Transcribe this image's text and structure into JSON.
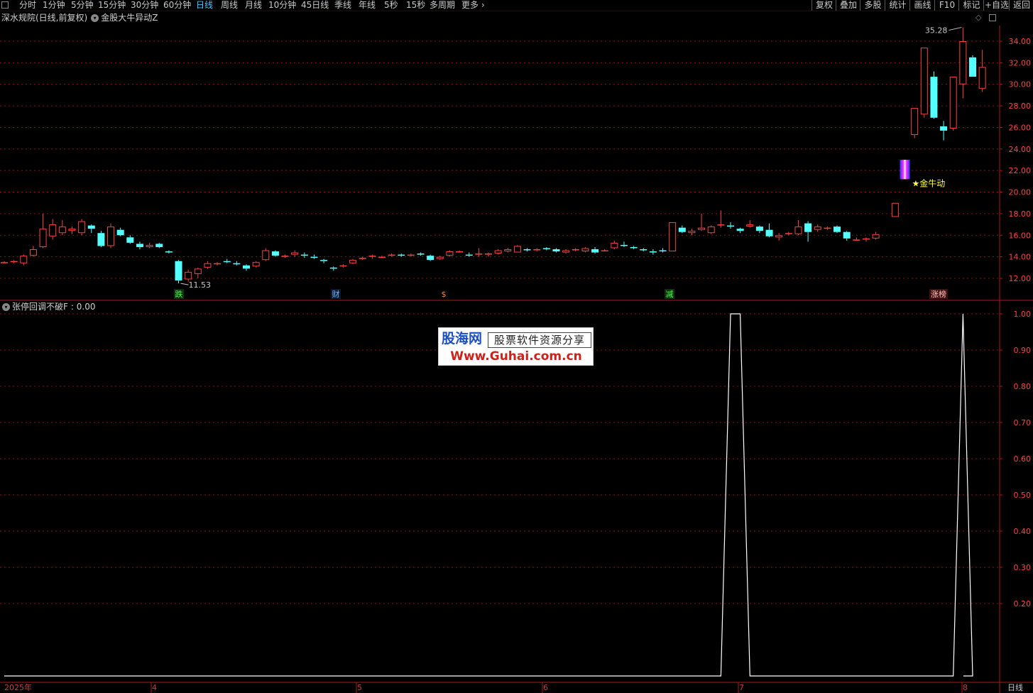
{
  "toolbar": {
    "periods": [
      "分时",
      "1分钟",
      "5分钟",
      "15分钟",
      "30分钟",
      "60分钟",
      "日线",
      "周线",
      "月线",
      "10分钟",
      "45日线",
      "季线",
      "年线",
      "5秒",
      "15秒",
      "多周期",
      "更多 ›"
    ],
    "active_period": "日线",
    "right_buttons": [
      "复权",
      "叠加",
      "多股",
      "统计",
      "画线",
      "F10",
      "标记",
      "+自选",
      "返回"
    ]
  },
  "info": {
    "stock_name": "深水规院(日线,前复权)",
    "indicator_name": "金股大牛异动Z"
  },
  "indicator_panel": {
    "title": "张停回调不破F",
    "value_label": ": 0.00"
  },
  "annotations": {
    "max_price_label": "35.28",
    "min_price_label": "11.53",
    "signal_label": "★金牛动",
    "event_markers": [
      "跌",
      "财",
      "$",
      "减",
      "涨榜"
    ]
  },
  "watermark": {
    "brand": "股海网",
    "slogan": "股票软件资源分享",
    "url": "Www.Guhai.com.cn"
  },
  "bottom": {
    "year_label": "2025年",
    "month_labels": [
      "4",
      "5",
      "6",
      "7",
      "8"
    ],
    "period_label": "日线"
  },
  "colors": {
    "up": "#ff4040",
    "down": "#54ffff",
    "grid": "#8b1010",
    "axis": "#b01818",
    "indicator_line": "#ffffff",
    "active_tab": "#3ec8ff"
  },
  "chart_data": [
    {
      "type": "candlestick",
      "title": "深水规院(日线,前复权)",
      "y_ticks": [
        "34.00",
        "32.00",
        "30.00",
        "28.00",
        "26.00",
        "24.00",
        "22.00",
        "20.00",
        "18.00",
        "16.00",
        "14.00",
        "12.00"
      ],
      "ylim": [
        10.5,
        35.9
      ],
      "candles": [
        {
          "o": 13.5,
          "h": 13.6,
          "l": 13.4,
          "c": 13.5
        },
        {
          "o": 13.5,
          "h": 13.7,
          "l": 13.4,
          "c": 13.6
        },
        {
          "o": 13.4,
          "h": 14.2,
          "l": 13.2,
          "c": 14.1
        },
        {
          "o": 14.1,
          "h": 15.0,
          "l": 14.0,
          "c": 14.7
        },
        {
          "o": 14.9,
          "h": 18.0,
          "l": 14.8,
          "c": 16.6
        },
        {
          "o": 15.9,
          "h": 17.5,
          "l": 15.6,
          "c": 17.0
        },
        {
          "o": 16.2,
          "h": 17.4,
          "l": 16.0,
          "c": 16.8
        },
        {
          "o": 16.4,
          "h": 16.8,
          "l": 16.1,
          "c": 16.6
        },
        {
          "o": 16.2,
          "h": 17.5,
          "l": 16.0,
          "c": 17.3
        },
        {
          "o": 16.9,
          "h": 17.0,
          "l": 16.2,
          "c": 16.6
        },
        {
          "o": 16.2,
          "h": 16.4,
          "l": 14.9,
          "c": 15.0
        },
        {
          "o": 15.0,
          "h": 17.1,
          "l": 14.8,
          "c": 16.8
        },
        {
          "o": 16.5,
          "h": 16.7,
          "l": 15.9,
          "c": 16.0
        },
        {
          "o": 15.8,
          "h": 16.0,
          "l": 15.2,
          "c": 15.3
        },
        {
          "o": 15.2,
          "h": 15.4,
          "l": 14.7,
          "c": 14.9
        },
        {
          "o": 14.9,
          "h": 15.3,
          "l": 14.8,
          "c": 15.1
        },
        {
          "o": 15.2,
          "h": 15.3,
          "l": 14.8,
          "c": 14.9
        },
        {
          "o": 14.5,
          "h": 14.6,
          "l": 14.3,
          "c": 14.4
        },
        {
          "o": 13.6,
          "h": 13.7,
          "l": 11.53,
          "c": 11.8
        },
        {
          "o": 11.9,
          "h": 12.8,
          "l": 11.7,
          "c": 12.6
        },
        {
          "o": 12.4,
          "h": 13.0,
          "l": 12.0,
          "c": 12.9
        },
        {
          "o": 13.0,
          "h": 13.6,
          "l": 12.9,
          "c": 13.4
        },
        {
          "o": 13.3,
          "h": 13.5,
          "l": 13.2,
          "c": 13.4
        },
        {
          "o": 13.6,
          "h": 13.8,
          "l": 13.4,
          "c": 13.5
        },
        {
          "o": 13.4,
          "h": 13.6,
          "l": 13.2,
          "c": 13.3
        },
        {
          "o": 13.2,
          "h": 13.3,
          "l": 12.7,
          "c": 12.9
        },
        {
          "o": 13.1,
          "h": 13.6,
          "l": 13.0,
          "c": 13.5
        },
        {
          "o": 13.7,
          "h": 14.8,
          "l": 13.6,
          "c": 14.6
        },
        {
          "o": 14.5,
          "h": 14.6,
          "l": 14.0,
          "c": 14.1
        },
        {
          "o": 14.0,
          "h": 14.2,
          "l": 13.9,
          "c": 14.1
        },
        {
          "o": 14.2,
          "h": 14.6,
          "l": 14.0,
          "c": 14.4
        },
        {
          "o": 14.2,
          "h": 14.4,
          "l": 13.9,
          "c": 14.1
        },
        {
          "o": 14.0,
          "h": 14.2,
          "l": 13.8,
          "c": 13.9
        },
        {
          "o": 13.7,
          "h": 13.8,
          "l": 13.4,
          "c": 13.6
        },
        {
          "o": 13.0,
          "h": 13.1,
          "l": 12.7,
          "c": 12.9
        },
        {
          "o": 13.1,
          "h": 13.3,
          "l": 13.0,
          "c": 13.2
        },
        {
          "o": 13.4,
          "h": 13.8,
          "l": 13.3,
          "c": 13.7
        },
        {
          "o": 13.8,
          "h": 14.0,
          "l": 13.7,
          "c": 13.9
        },
        {
          "o": 14.0,
          "h": 14.2,
          "l": 13.8,
          "c": 14.1
        },
        {
          "o": 14.0,
          "h": 14.1,
          "l": 13.9,
          "c": 14.0
        },
        {
          "o": 14.1,
          "h": 14.3,
          "l": 14.0,
          "c": 14.2
        },
        {
          "o": 14.2,
          "h": 14.3,
          "l": 14.0,
          "c": 14.1
        },
        {
          "o": 14.1,
          "h": 14.3,
          "l": 14.0,
          "c": 14.2
        },
        {
          "o": 14.3,
          "h": 14.4,
          "l": 14.1,
          "c": 14.2
        },
        {
          "o": 14.1,
          "h": 14.2,
          "l": 13.6,
          "c": 13.7
        },
        {
          "o": 13.8,
          "h": 14.1,
          "l": 13.7,
          "c": 14.0
        },
        {
          "o": 14.1,
          "h": 14.6,
          "l": 14.0,
          "c": 14.5
        },
        {
          "o": 14.5,
          "h": 14.6,
          "l": 14.4,
          "c": 14.5
        },
        {
          "o": 14.2,
          "h": 14.4,
          "l": 14.0,
          "c": 14.1
        },
        {
          "o": 14.2,
          "h": 14.8,
          "l": 14.0,
          "c": 14.3
        },
        {
          "o": 14.2,
          "h": 14.4,
          "l": 14.0,
          "c": 14.3
        },
        {
          "o": 14.3,
          "h": 14.7,
          "l": 14.2,
          "c": 14.6
        },
        {
          "o": 14.5,
          "h": 14.8,
          "l": 14.4,
          "c": 14.7
        },
        {
          "o": 14.4,
          "h": 15.1,
          "l": 14.4,
          "c": 15.0
        },
        {
          "o": 14.7,
          "h": 14.8,
          "l": 14.5,
          "c": 14.6
        },
        {
          "o": 14.6,
          "h": 14.8,
          "l": 14.5,
          "c": 14.7
        },
        {
          "o": 14.8,
          "h": 14.9,
          "l": 14.6,
          "c": 14.7
        },
        {
          "o": 14.7,
          "h": 14.8,
          "l": 14.4,
          "c": 14.5
        },
        {
          "o": 14.4,
          "h": 14.7,
          "l": 14.3,
          "c": 14.6
        },
        {
          "o": 14.6,
          "h": 14.8,
          "l": 14.5,
          "c": 14.7
        },
        {
          "o": 14.5,
          "h": 14.9,
          "l": 14.4,
          "c": 14.8
        },
        {
          "o": 14.7,
          "h": 14.9,
          "l": 14.3,
          "c": 14.4
        },
        {
          "o": 14.6,
          "h": 14.7,
          "l": 14.5,
          "c": 14.6
        },
        {
          "o": 14.8,
          "h": 15.5,
          "l": 14.7,
          "c": 15.3
        },
        {
          "o": 15.1,
          "h": 15.4,
          "l": 14.9,
          "c": 15.0
        },
        {
          "o": 14.9,
          "h": 15.0,
          "l": 14.7,
          "c": 14.8
        },
        {
          "o": 14.7,
          "h": 14.8,
          "l": 14.5,
          "c": 14.6
        },
        {
          "o": 14.5,
          "h": 14.7,
          "l": 14.2,
          "c": 14.4
        },
        {
          "o": 14.6,
          "h": 14.8,
          "l": 14.4,
          "c": 14.5
        },
        {
          "o": 14.5,
          "h": 17.2,
          "l": 14.5,
          "c": 17.2
        },
        {
          "o": 16.7,
          "h": 16.9,
          "l": 16.2,
          "c": 16.3
        },
        {
          "o": 16.2,
          "h": 16.6,
          "l": 16.0,
          "c": 16.4
        },
        {
          "o": 16.5,
          "h": 18.0,
          "l": 16.4,
          "c": 16.7
        },
        {
          "o": 16.2,
          "h": 16.9,
          "l": 16.1,
          "c": 16.8
        },
        {
          "o": 16.9,
          "h": 18.3,
          "l": 16.7,
          "c": 17.0
        },
        {
          "o": 16.9,
          "h": 17.2,
          "l": 16.6,
          "c": 16.8
        },
        {
          "o": 16.6,
          "h": 16.7,
          "l": 16.2,
          "c": 16.4
        },
        {
          "o": 16.8,
          "h": 17.4,
          "l": 16.7,
          "c": 17.0
        },
        {
          "o": 16.8,
          "h": 16.9,
          "l": 16.2,
          "c": 16.4
        },
        {
          "o": 16.5,
          "h": 17.1,
          "l": 15.8,
          "c": 15.9
        },
        {
          "o": 15.8,
          "h": 16.2,
          "l": 15.5,
          "c": 16.0
        },
        {
          "o": 16.1,
          "h": 16.3,
          "l": 16.0,
          "c": 16.2
        },
        {
          "o": 16.1,
          "h": 17.4,
          "l": 16.0,
          "c": 16.8
        },
        {
          "o": 17.1,
          "h": 17.3,
          "l": 15.4,
          "c": 16.3
        },
        {
          "o": 16.5,
          "h": 17.0,
          "l": 16.3,
          "c": 16.8
        },
        {
          "o": 16.6,
          "h": 16.8,
          "l": 16.5,
          "c": 16.7
        },
        {
          "o": 16.8,
          "h": 16.9,
          "l": 16.2,
          "c": 16.3
        },
        {
          "o": 16.3,
          "h": 16.4,
          "l": 15.5,
          "c": 15.7
        },
        {
          "o": 15.6,
          "h": 15.8,
          "l": 15.5,
          "c": 15.6
        },
        {
          "o": 15.6,
          "h": 15.8,
          "l": 15.4,
          "c": 15.7
        },
        {
          "o": 15.7,
          "h": 16.3,
          "l": 15.6,
          "c": 16.1
        },
        null,
        {
          "o": 17.7,
          "h": 19.0,
          "l": 17.7,
          "c": 19.0
        },
        {
          "o": 21.2,
          "h": 23.0,
          "l": 21.2,
          "c": 23.0
        },
        {
          "o": 25.3,
          "h": 27.8,
          "l": 25.0,
          "c": 27.8
        },
        {
          "o": 27.2,
          "h": 33.4,
          "l": 26.9,
          "c": 33.4
        },
        {
          "o": 30.7,
          "h": 31.2,
          "l": 26.8,
          "c": 26.9
        },
        {
          "o": 26.1,
          "h": 26.6,
          "l": 24.8,
          "c": 25.7
        },
        {
          "o": 25.9,
          "h": 30.7,
          "l": 25.7,
          "c": 30.7
        },
        {
          "o": 30.0,
          "h": 35.28,
          "l": 28.7,
          "c": 34.0
        },
        {
          "o": 32.5,
          "h": 32.7,
          "l": 30.7,
          "c": 30.7
        },
        {
          "o": 29.6,
          "h": 33.2,
          "l": 29.3,
          "c": 31.6
        }
      ],
      "signal_candle_index": 93
    },
    {
      "type": "line",
      "title": "张停回调不破F",
      "y_ticks": [
        "1.00",
        "0.90",
        "0.80",
        "0.70",
        "0.60",
        "0.50",
        "0.40",
        "0.30",
        "0.20"
      ],
      "ylim": [
        -0.02,
        1.0
      ],
      "series": [
        {
          "name": "张停回调不破F",
          "values": [
            0,
            0,
            0,
            0,
            0,
            0,
            0,
            0,
            0,
            0,
            0,
            0,
            0,
            0,
            0,
            0,
            0,
            0,
            0,
            0,
            0,
            0,
            0,
            0,
            0,
            0,
            0,
            0,
            0,
            0,
            0,
            0,
            0,
            0,
            0,
            0,
            0,
            0,
            0,
            0,
            0,
            0,
            0,
            0,
            0,
            0,
            0,
            0,
            0,
            0,
            0,
            0,
            0,
            0,
            0,
            0,
            0,
            0,
            0,
            0,
            0,
            0,
            0,
            0,
            0,
            0,
            0,
            0,
            0,
            0,
            0,
            0,
            0,
            0,
            0,
            1,
            1,
            0,
            0,
            0,
            0,
            0,
            0,
            0,
            0,
            0,
            0,
            0,
            0,
            0,
            0,
            0,
            0,
            0,
            0,
            0,
            0,
            0,
            0,
            1,
            0
          ]
        }
      ]
    }
  ]
}
